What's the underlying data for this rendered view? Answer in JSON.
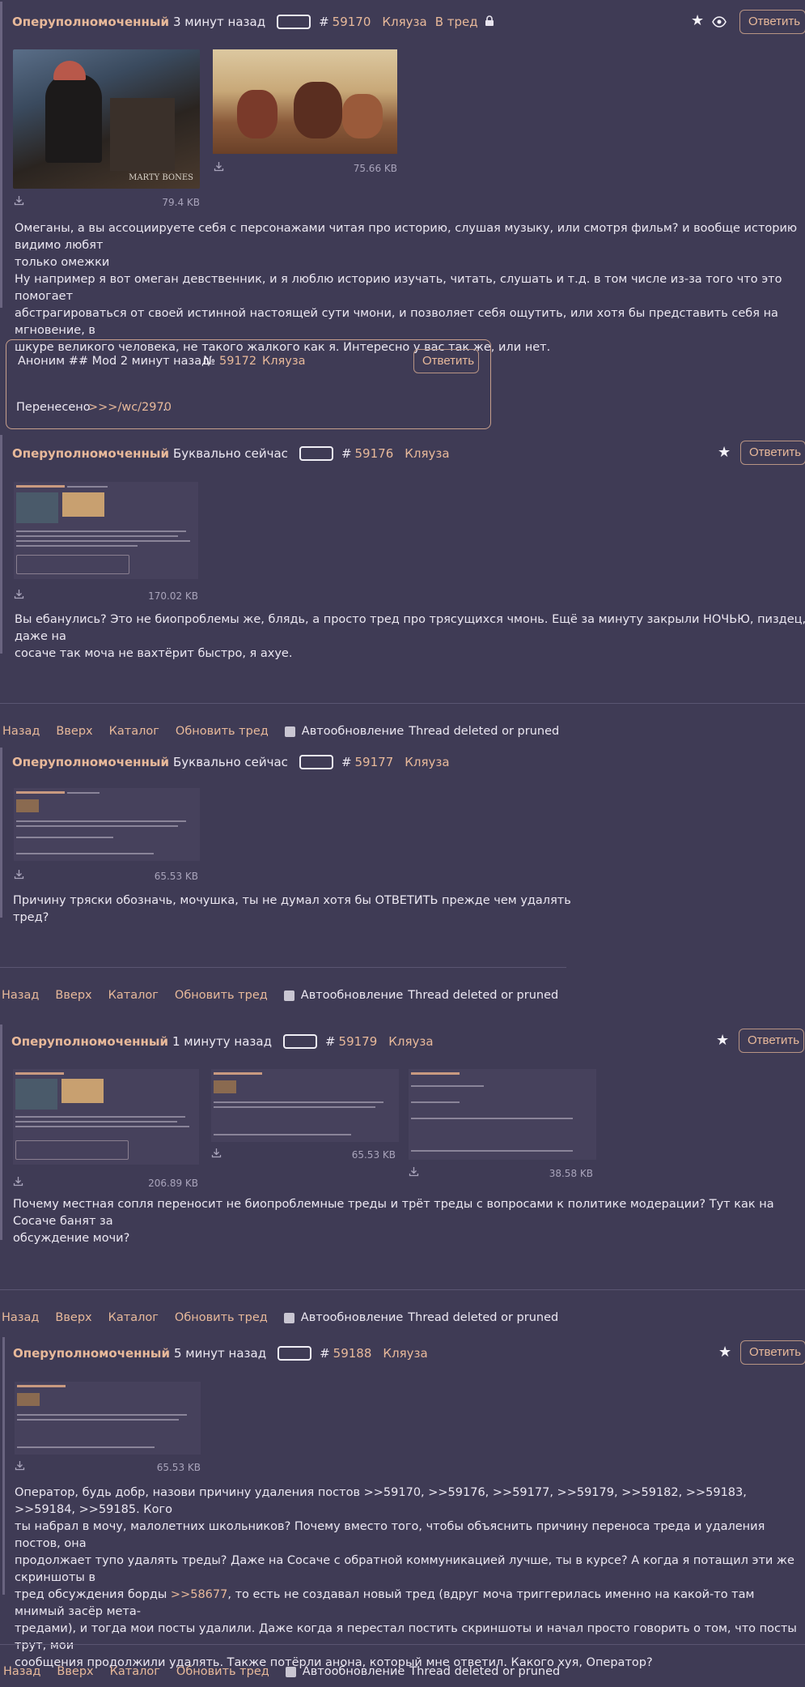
{
  "common": {
    "reply_label": "Ответить",
    "hash": "#",
    "nav": {
      "back": "Назад",
      "up": "Вверх",
      "catalog": "Каталог",
      "refresh": "Обновить тред",
      "autorefresh": "Автообновление",
      "status": "Thread deleted or pruned"
    }
  },
  "post1": {
    "name": "Оперуполномоченный",
    "time": "3 минут назад",
    "number": "59170",
    "board": "Кляуза",
    "thread_link": "В тред",
    "image1_caption": "MARTY BONES",
    "image1_size": "79.4 KB",
    "image2_size": "75.66 KB",
    "lines": [
      "Омеганы, а вы ассоциируете себя с персонажами читая про историю, слушая музыку, или смотря фильм? и вообще историю видимо любят",
      "только омежки",
      "Ну например я вот омеган девственник, и я люблю историю изучать, читать, слушать и т.д. в том числе из-за того что это помогает",
      "абстрагироваться от своей истинной настоящей сути чмони, и позволяет себя ощутить, или хотя бы представить себя на мгновение, в",
      "шкуре великого человека, не такого жалкого как я. Интересно у вас так же, или нет."
    ]
  },
  "mod": {
    "author": "Аноним ## Mod 2 минут назад",
    "number_prefix": "№",
    "number": "59172",
    "board": "Кляуза",
    "moved_text": "Перенесено",
    "moved_link": ">>>/wc/2970",
    "moved_suffix": "."
  },
  "post2": {
    "name": "Оперуполномоченный",
    "time": "Буквально сейчас",
    "number": "59176",
    "board": "Кляуза",
    "image_size": "170.02 KB",
    "lines": [
      "Вы ебанулись? Это не биопроблемы же, блядь, а просто тред про трясущихся чмонь. Ещё за минуту закрыли НОЧЬЮ, пиздец, даже на",
      "сосаче так моча не вахтёрит быстро, я ахуе."
    ]
  },
  "post3": {
    "name": "Оперуполномоченный",
    "time": "Буквально сейчас",
    "number": "59177",
    "board": "Кляуза",
    "image_size": "65.53 KB",
    "lines": [
      "Причину тряски обозначь, мочушка, ты не думал хотя бы ОТВЕТИТЬ прежде чем удалять тред?"
    ]
  },
  "post4": {
    "name": "Оперуполномоченный",
    "time": "1 минуту назад",
    "number": "59179",
    "board": "Кляуза",
    "image1_size": "206.89 KB",
    "image2_size": "65.53 KB",
    "image3_size": "38.58 KB",
    "lines": [
      "Почему местная сопля переносит не биопроблемные треды и трёт треды с вопросами к политике модерации? Тут как на Сосаче банят за",
      "обсуждение мочи?"
    ]
  },
  "post5": {
    "name": "Оперуполномоченный",
    "time": "5 минут назад",
    "number": "59188",
    "board": "Кляуза",
    "image_size": "65.53 KB",
    "line1": "Оператор, будь добр, назови причину удаления постов >>59170, >>59176, >>59177, >>59179, >>59182, >>59183, >>59184, >>59185. Кого",
    "line2": "ты набрал в мочу, малолетних школьников? Почему вместо того, чтобы объяснить причину переноса треда и удаления постов, она",
    "line3": "продолжает тупо удалять треды? Даже на Сосаче с обратной коммуникацией лучше, ты в курсе? А когда я потащил эти же скриншоты в",
    "line4_pre": "тред обсуждения борды ",
    "line4_link": ">>58677",
    "line4_post": ", то есть не создавал новый тред (вдруг моча триггерилась именно на какой-то там мнимый засёр мета-",
    "line5": "тредами), и тогда мои посты удалили. Даже когда я перестал постить скриншоты и начал просто говорить о том, что посты трут, мои",
    "line6": "сообщения продолжили удалять. Также потёрли анона, который мне ответил. Какого хуя, Оператор?"
  }
}
